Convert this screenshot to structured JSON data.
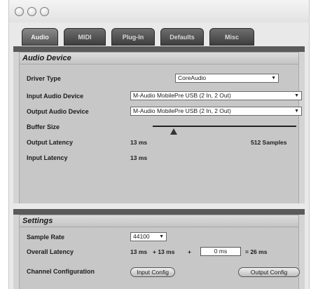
{
  "tabs": [
    "Audio",
    "MIDI",
    "Plug-In",
    "Defaults",
    "Misc"
  ],
  "audio_device": {
    "header": "Audio Device",
    "driver_type_label": "Driver Type",
    "driver_type_value": "CoreAudio",
    "input_device_label": "Input Audio Device",
    "input_device_value": "M-Audio MobilePre USB (2 In, 2 Out)",
    "output_device_label": "Output Audio Device",
    "output_device_value": "M-Audio MobilePre USB (2 In, 2 Out)",
    "buffer_size_label": "Buffer Size",
    "buffer_size_value": "512 Samples",
    "output_latency_label": "Output Latency",
    "output_latency_value": "13 ms",
    "input_latency_label": "Input Latency",
    "input_latency_value": "13 ms"
  },
  "settings": {
    "header": "Settings",
    "sample_rate_label": "Sample Rate",
    "sample_rate_value": "44100",
    "overall_latency_label": "Overall Latency",
    "latency_part1": "13 ms",
    "latency_plus1": "+ 13 ms",
    "latency_plus2": "+",
    "latency_extra": "0 ms",
    "latency_total": "= 26 ms",
    "channel_config_label": "Channel Configuration",
    "input_config_button": "Input Config",
    "output_config_button": "Output Config"
  },
  "icons": {
    "dropdown": "chevron-down-icon",
    "window_buttons": "window-control-icon"
  }
}
